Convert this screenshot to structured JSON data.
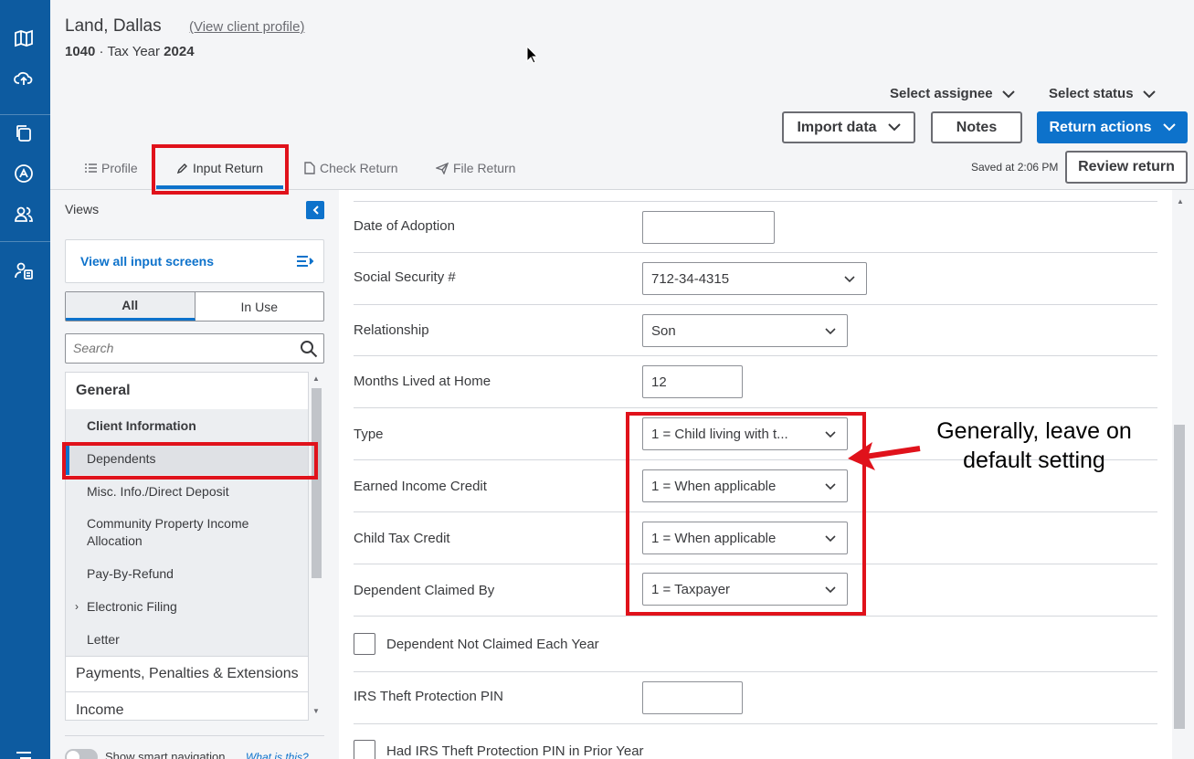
{
  "client": {
    "name": "Land, Dallas",
    "profile_link": "(View client profile)",
    "form": "1040",
    "year_label": "Tax Year",
    "year": "2024",
    "separator": "·"
  },
  "header": {
    "select_assignee": "Select assignee",
    "select_status": "Select status",
    "import_data": "Import data",
    "notes": "Notes",
    "return_actions": "Return actions",
    "saved": "Saved at 2:06 PM",
    "review_return": "Review return"
  },
  "tabs": [
    {
      "label": "Profile",
      "icon": "list-icon"
    },
    {
      "label": "Input Return",
      "icon": "pencil-icon",
      "active": true
    },
    {
      "label": "Check Return",
      "icon": "document-icon"
    },
    {
      "label": "File Return",
      "icon": "send-icon"
    }
  ],
  "sidebar": {
    "views_label": "Views",
    "view_all": "View all input screens",
    "segments": [
      "All",
      "In Use"
    ],
    "search_placeholder": "Search",
    "groups": [
      {
        "label": "General",
        "items": [
          {
            "label": "Client Information"
          },
          {
            "label": "Dependents",
            "selected": true
          },
          {
            "label": "Misc. Info./Direct Deposit"
          },
          {
            "label": "Community Property Income Allocation"
          },
          {
            "label": "Pay-By-Refund"
          },
          {
            "label": "Electronic Filing",
            "expandable": true
          },
          {
            "label": "Letter"
          }
        ]
      },
      {
        "label": "Payments, Penalties & Extensions"
      },
      {
        "label": "Income"
      }
    ],
    "smart_nav_label": "Show smart navigation",
    "smart_nav_link": "What is this?"
  },
  "form": {
    "date_of_adoption": {
      "label": "Date of Adoption",
      "value": ""
    },
    "ssn": {
      "label": "Social Security #",
      "value": "712-34-4315"
    },
    "relationship": {
      "label": "Relationship",
      "value": "Son"
    },
    "months_lived": {
      "label": "Months Lived at Home",
      "value": "12"
    },
    "type": {
      "label": "Type",
      "value": "1 = Child living with t..."
    },
    "eic": {
      "label": "Earned Income Credit",
      "value": "1 = When applicable"
    },
    "ctc": {
      "label": "Child Tax Credit",
      "value": "1 = When applicable"
    },
    "claimed_by": {
      "label": "Dependent Claimed By",
      "value": "1 = Taxpayer"
    },
    "not_claimed_each_year": {
      "label": "Dependent Not Claimed Each Year",
      "checked": false
    },
    "ip_pin": {
      "label": "IRS Theft Protection PIN",
      "value": ""
    },
    "had_ip_pin": {
      "label": "Had IRS Theft Protection PIN in Prior Year",
      "checked": false
    }
  },
  "annotation": {
    "text": "Generally, leave on default setting",
    "color": "#e0121b"
  },
  "colors": {
    "rail": "#0d5ba0",
    "accent": "#0d72cb",
    "highlight": "#e0121b"
  }
}
